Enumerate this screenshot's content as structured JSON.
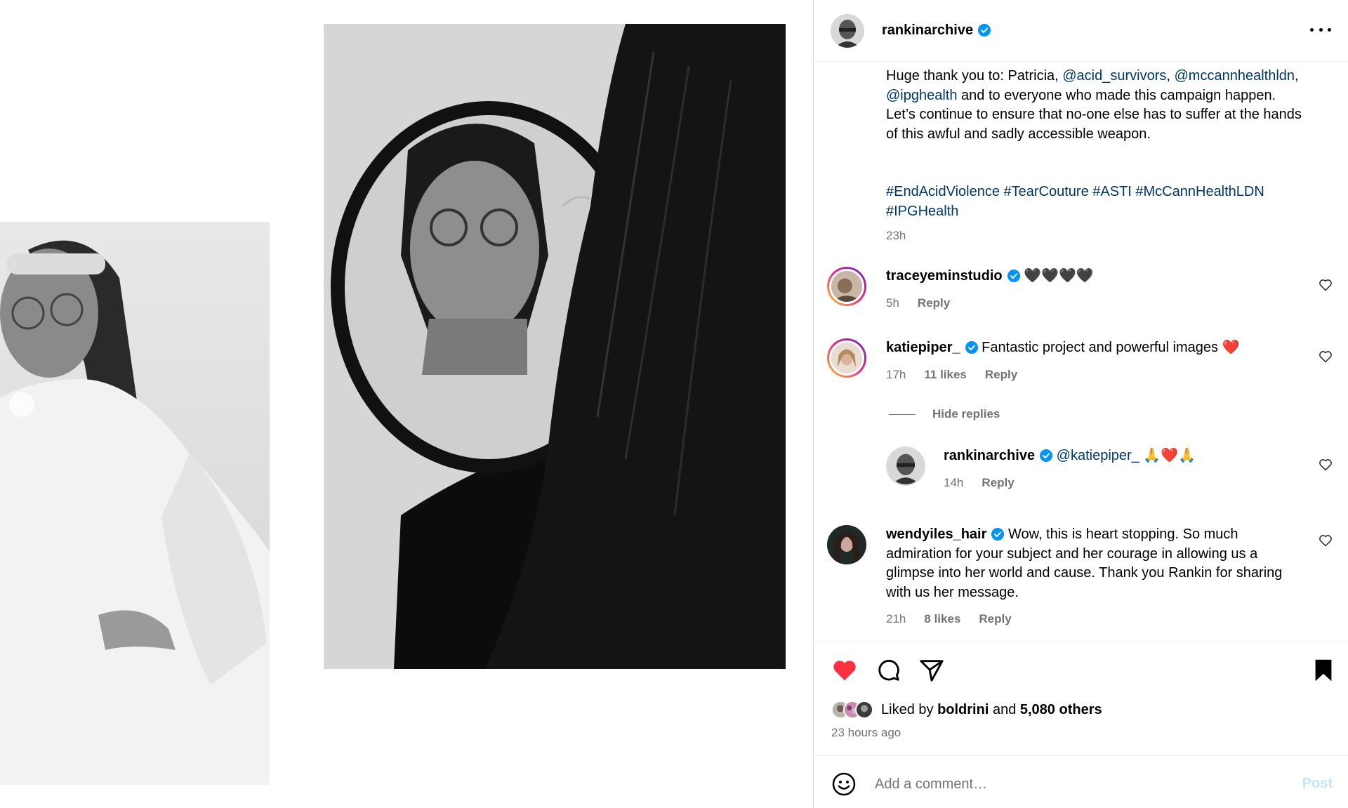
{
  "header": {
    "username": "rankinarchive",
    "verified": true,
    "more_icon": "more-horizontal-icon"
  },
  "caption": {
    "text_before": "Huge thank you to: Patricia, ",
    "mention_1": "@acid_survivors",
    "sep_1": ",",
    "mention_2": "@mccannhealthldn",
    "sep_2": ", ",
    "mention_3": "@ipghealth",
    "text_after": " and to everyone who made this campaign happen. Let’s continue to ensure that no-one else has to suffer at the hands of this awful and sadly accessible weapon.",
    "hashtags": "#EndAcidViolence #TearCouture #ASTI #McCannHealthLDN #IPGHealth",
    "time": "23h"
  },
  "comments": [
    {
      "username": "traceyeminstudio",
      "text": "🖤🖤🖤🖤",
      "time": "5h",
      "likes": "",
      "reply": "Reply"
    },
    {
      "username": "katiepiper_",
      "text": "Fantastic project and powerful images ❤️",
      "time": "17h",
      "likes": "11 likes",
      "reply": "Reply"
    },
    {
      "username": "wendyiles_hair",
      "text": "Wow, this is heart stopping. So much admiration for your subject and her courage in allowing us a glimpse into her world and cause. Thank you Rankin for sharing with us her message.",
      "time": "21h",
      "likes": "8 likes",
      "reply": "Reply"
    }
  ],
  "hide_replies": "Hide replies",
  "reply": {
    "username": "rankinarchive",
    "mention": "@katiepiper_",
    "text": " 🙏❤️🙏",
    "time": "14h",
    "reply": "Reply"
  },
  "actions": {
    "liked": true,
    "like_color": "#ff3040",
    "icons": [
      "heart-filled-icon",
      "comment-icon",
      "share-icon",
      "bookmark-filled-icon"
    ]
  },
  "likes": {
    "prefix": "Liked by ",
    "user": "boldrini",
    "middle": " and ",
    "count": "5,080 others"
  },
  "post_time": "23 hours ago",
  "comment_box": {
    "placeholder": "Add a comment…",
    "post_label": "Post",
    "post_color": "#c5e4fd"
  },
  "colors": {
    "link": "#00376b",
    "verified": "#0095f6",
    "secondary_text": "#737373"
  }
}
